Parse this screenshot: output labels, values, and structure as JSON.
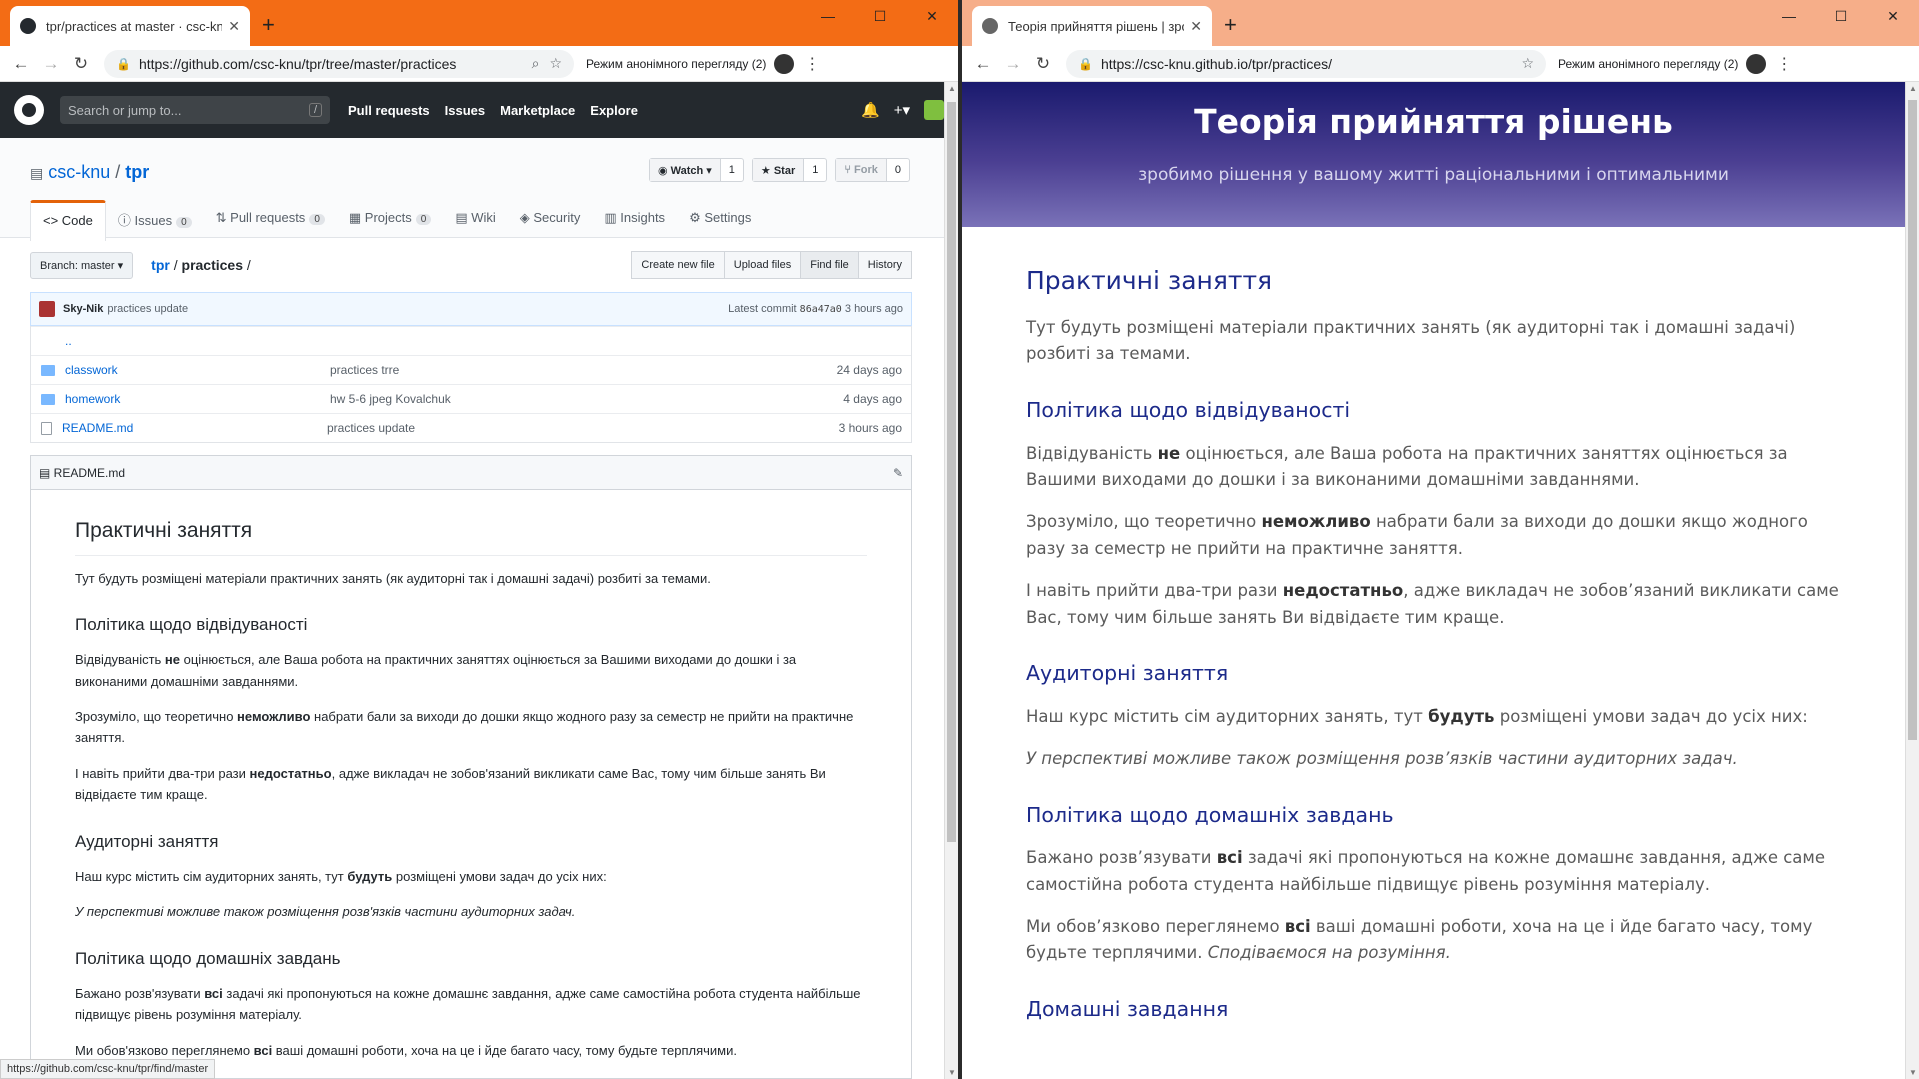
{
  "left": {
    "tab_title": "tpr/practices at master · csc-knu/",
    "url": "https://github.com/csc-knu/tpr/tree/master/practices",
    "incognito": "Режим анонімного перегляду (2)",
    "search_placeholder": "Search or jump to...",
    "search_key": "/",
    "nav": [
      "Pull requests",
      "Issues",
      "Marketplace",
      "Explore"
    ],
    "repo_owner": "csc-knu",
    "repo_name": "tpr",
    "watch": {
      "label": "Watch",
      "count": "1"
    },
    "star": {
      "label": "Star",
      "count": "1"
    },
    "fork": {
      "label": "Fork",
      "count": "0"
    },
    "tabs": [
      {
        "label": "Code"
      },
      {
        "label": "Issues",
        "count": "0"
      },
      {
        "label": "Pull requests",
        "count": "0"
      },
      {
        "label": "Projects",
        "count": "0"
      },
      {
        "label": "Wiki"
      },
      {
        "label": "Security"
      },
      {
        "label": "Insights"
      },
      {
        "label": "Settings"
      }
    ],
    "branch": "Branch: master",
    "bread_repo": "tpr",
    "bread_dir": "practices",
    "file_buttons": [
      "Create new file",
      "Upload files",
      "Find file",
      "History"
    ],
    "commit": {
      "author": "Sky-Nik",
      "message": "practices update",
      "latest": "Latest commit",
      "sha": "86a47a0",
      "age": "3 hours ago"
    },
    "parent": "..",
    "files": [
      {
        "name": "classwork",
        "msg": "practices trre",
        "age": "24 days ago"
      },
      {
        "name": "homework",
        "msg": "hw 5-6 jpeg Kovalchuk",
        "age": "4 days ago"
      },
      {
        "name": "README.md",
        "msg": "practices update",
        "age": "3 hours ago"
      }
    ],
    "readme_title": "README.md",
    "status_url": "https://github.com/csc-knu/tpr/find/master"
  },
  "content": {
    "h_main": "Практичні заняття",
    "intro": "Тут будуть розміщені матеріали практичних занять (як аудиторні так і домашні задачі) розбиті за темами.",
    "h_attend": "Політика щодо відвідуваності",
    "a1_pre": "Відвідуваність ",
    "a1_b": "не",
    "a1_post": " оцінюється, але Ваша робота на практичних заняттях оцінюється за Вашими виходами до дошки і за виконаними домашніми завданнями.",
    "a2_pre": "Зрозуміло, що теоретично ",
    "a2_b": "неможливо",
    "a2_post": " набрати бали за виходи до дошки якщо жодного разу за семестр не прийти на практичне заняття.",
    "a3_pre": "І навіть прийти два-три рази ",
    "a3_b": "недостатньо",
    "a3_post": ", адже викладач не зобов’язаний викликати саме Вас, тому чим більше занять Ви відвідаєте тим краще.",
    "a3_post_md": ", адже викладач не зобов'язаний викликати саме Вас, тому чим більше занять Ви відвідаєте тим краще.",
    "h_class": "Аудиторні заняття",
    "c1_pre": "Наш курс містить сім аудиторних занять, тут ",
    "c1_b": "будуть",
    "c1_post": " розміщені умови задач до усіх них:",
    "c2": "У перспективі можливе також розміщення розв’язків частини аудиторних задач.",
    "c2_md": "У перспективі можливе також розміщення розв'язків частини аудиторних задач.",
    "h_home": "Політика щодо домашніх завдань",
    "h1_pre": "Бажано розв’язувати ",
    "h1_pre_md": "Бажано розв'язувати ",
    "h1_b": "всі",
    "h1_post": " задачі які пропонуються на кожне домашнє завдання, адже саме самостійна робота студента найбільше підвищує рівень розуміння матеріалу.",
    "h2_pre": "Ми обов’язково переглянемо ",
    "h2_pre_md": "Ми обов'язково переглянемо ",
    "h2_b": "всі",
    "h2_post": " ваші домашні роботи, хоча на це і йде багато часу, тому будьте терплячими.",
    "h2_em": "Сподіваємося на розуміння.",
    "h_homework": "Домашні завдання"
  },
  "right": {
    "tab_title": "Теорія прийняття рішень | зроб",
    "url": "https://csc-knu.github.io/tpr/practices/",
    "incognito": "Режим анонімного перегляду (2)",
    "site_title": "Теорія прийняття рішень",
    "site_subtitle": "зробимо рішення у вашому житті раціональними і оптимальними"
  }
}
